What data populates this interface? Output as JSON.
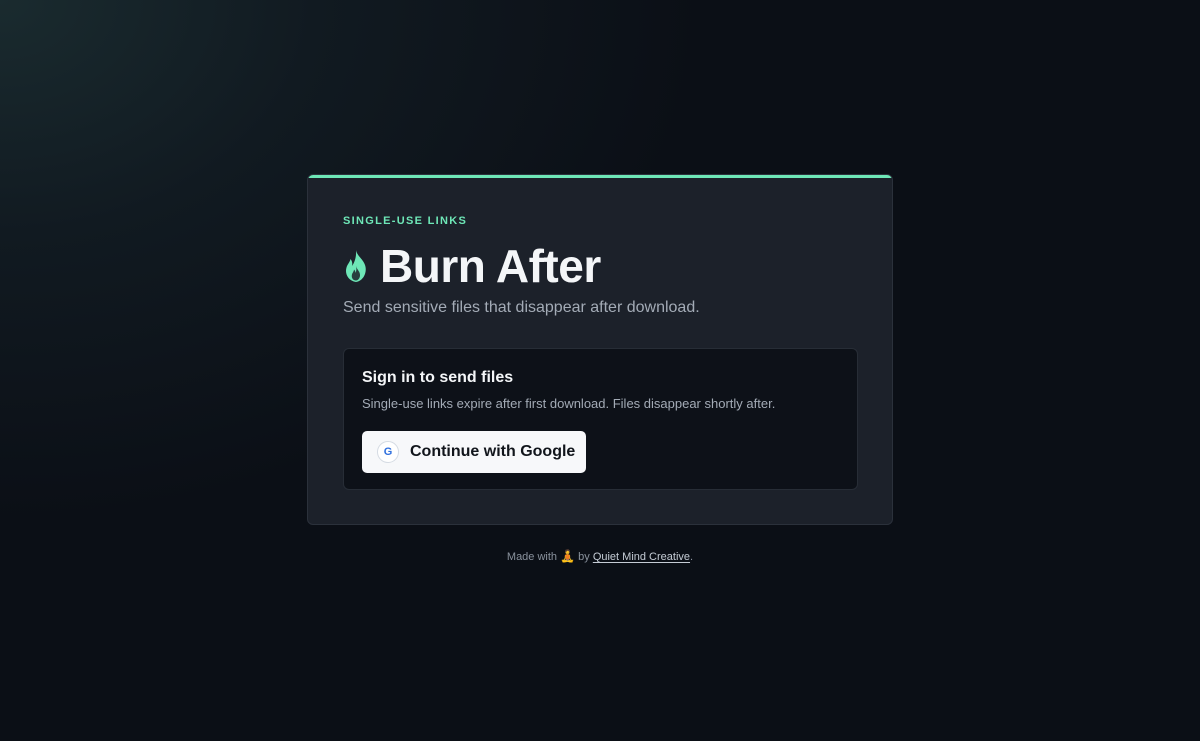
{
  "card": {
    "eyebrow": "SINGLE-USE LINKS",
    "title": "Burn After",
    "subtitle": "Send sensitive files that disappear after download.",
    "accent_color": "#6ee7b7"
  },
  "signin": {
    "title": "Sign in to send files",
    "description": "Single-use links expire after first download. Files disappear shortly after.",
    "google_button_label": "Continue with Google",
    "google_icon_letter": "G"
  },
  "footer": {
    "prefix": "Made with",
    "emoji": "🧘",
    "by": "by",
    "link_label": "Quiet Mind Creative",
    "suffix": "."
  }
}
